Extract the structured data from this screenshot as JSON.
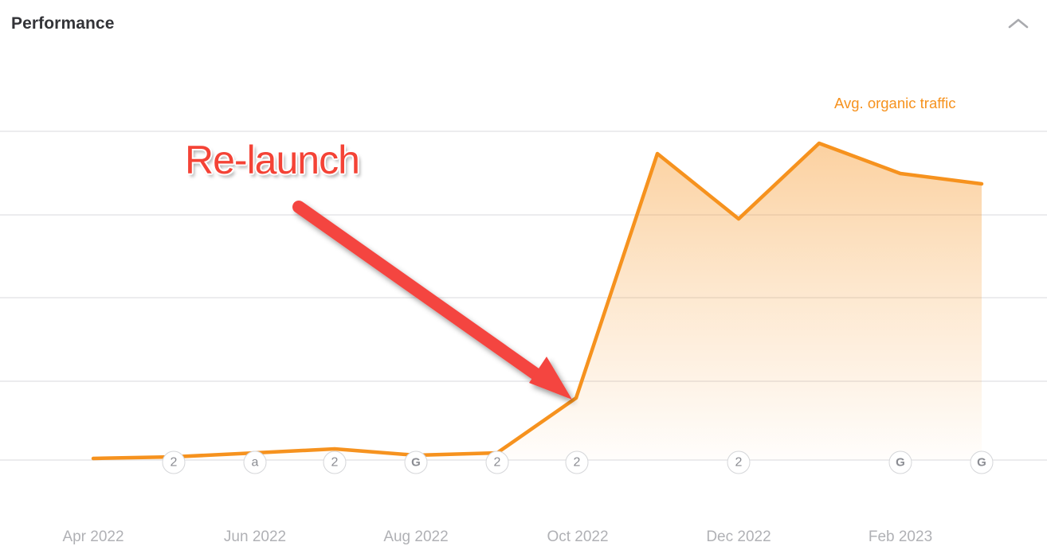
{
  "header": {
    "title": "Performance",
    "collapse_icon": "chevron-up-icon"
  },
  "legend": {
    "label": "Avg. organic traffic",
    "color": "#F6921E"
  },
  "annotation": {
    "text": "Re-launch",
    "color": "#F44336",
    "arrow": "red-arrow-icon"
  },
  "chart_data": {
    "type": "area",
    "title": "Performance",
    "xlabel": "",
    "ylabel": "",
    "grid": true,
    "legend_position": "top-right",
    "series": [
      {
        "name": "Avg. organic traffic",
        "color": "#F6921E",
        "fill": "orange-gradient",
        "x": [
          "Apr 2022",
          "May 2022",
          "Jun 2022",
          "Jul 2022",
          "Aug 2022",
          "Sep 2022",
          "Oct 2022",
          "Nov 2022",
          "Dec 2022",
          "Jan 2023",
          "Feb 2023",
          "Mar 2023"
        ],
        "values": [
          2,
          4,
          8,
          7,
          5,
          6,
          19,
          94,
          75,
          97,
          89,
          86
        ]
      }
    ],
    "ylim": [
      0,
      100
    ],
    "gridline_count": 5,
    "x_tick_labels": [
      "Apr 2022",
      "Jun 2022",
      "Aug 2022",
      "Oct 2022",
      "Dec 2022",
      "Feb 2023"
    ],
    "event_markers": [
      {
        "label": "2",
        "x": "May 2022"
      },
      {
        "label": "a",
        "x": "Jun 2022"
      },
      {
        "label": "2",
        "x": "Jul 2022"
      },
      {
        "label": "G",
        "x": "Aug 2022"
      },
      {
        "label": "2",
        "x": "Sep 2022"
      },
      {
        "label": "2",
        "x": "Oct 2022"
      },
      {
        "label": "2",
        "x": "Dec 2022"
      },
      {
        "label": "G",
        "x": "Feb 2023"
      },
      {
        "label": "G",
        "x": "Mar 2023"
      }
    ],
    "annotations": [
      {
        "text": "Re-launch",
        "points_to": "Oct 2022",
        "color": "#F44336"
      }
    ]
  }
}
